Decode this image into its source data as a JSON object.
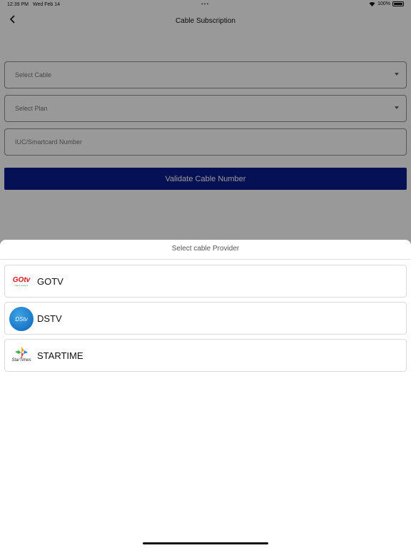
{
  "status_bar": {
    "time": "12:39 PM",
    "date": "Wed Feb 14",
    "dots": "•••",
    "battery": "100%"
  },
  "nav": {
    "title": "Cable Subscription",
    "back_icon": "chevron-left-icon"
  },
  "form": {
    "select_cable_placeholder": "Select Cable",
    "select_plan_placeholder": "Select Plan",
    "iuc_placeholder": "IUC/Smartcard Number",
    "validate_label": "Validate Cable Number"
  },
  "sheet": {
    "title": "Select cable Provider",
    "providers": [
      {
        "label": "GOTV",
        "logo_text": "GOtv",
        "logo_tagline": "Live it. Love it."
      },
      {
        "label": "DSTV",
        "logo_text": "DStv"
      },
      {
        "label": "STARTIME",
        "logo_text": "StarTimes"
      }
    ]
  },
  "colors": {
    "accent": "#0a1b8c",
    "overlay": "rgba(0,0,0,0.4)"
  }
}
